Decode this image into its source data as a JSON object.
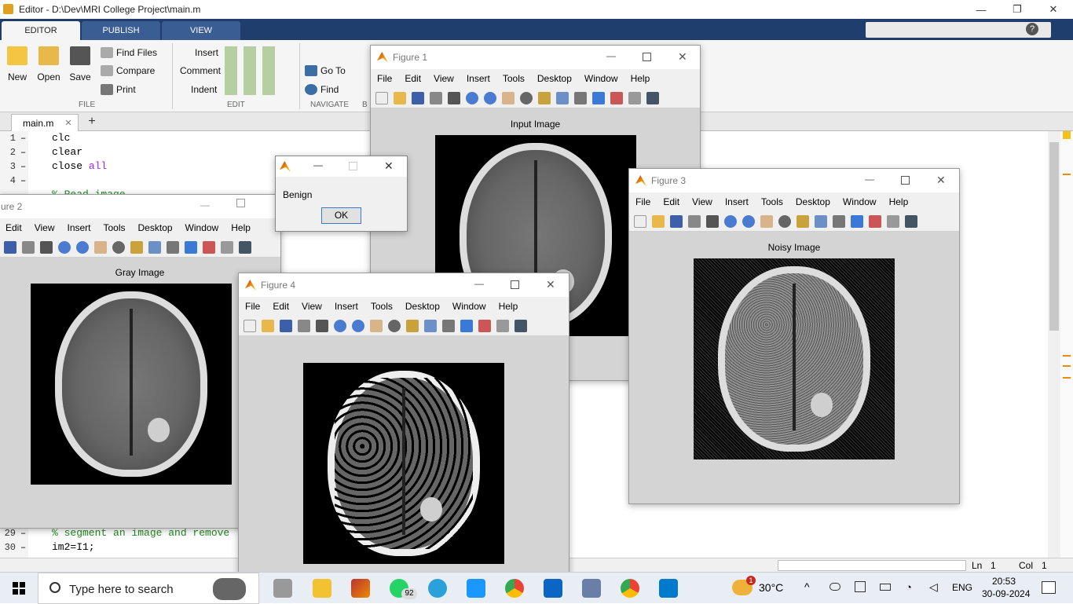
{
  "window": {
    "title": "Editor - D:\\Dev\\MRI College Project\\main.m",
    "minimize": "—",
    "maximize": "❐",
    "close": "✕"
  },
  "ribbon_tabs": [
    "EDITOR",
    "PUBLISH",
    "VIEW"
  ],
  "ribbon": {
    "new": "New",
    "open": "Open",
    "save": "Save",
    "find_files": "Find Files",
    "compare": "Compare",
    "print": "Print",
    "insert": "Insert",
    "comment": "Comment",
    "indent": "Indent",
    "goto": "Go To",
    "find": "Find",
    "groups": {
      "file": "FILE",
      "edit": "EDIT",
      "navigate": "NAVIGATE",
      "b": "B"
    }
  },
  "file_tab": {
    "name": "main.m",
    "close": "✕",
    "add": "+"
  },
  "code": {
    "lines": [
      {
        "num": "1",
        "text": "clc"
      },
      {
        "num": "2",
        "text": "clear"
      },
      {
        "num": "3",
        "text": "close",
        "keyword": "all"
      },
      {
        "num": "4",
        "text": ""
      },
      {
        "num": "29",
        "text": "% segment an image and remove"
      },
      {
        "num": "30",
        "text": "im2=I1;"
      }
    ],
    "partial_comment": "% Read image"
  },
  "figure_menu": [
    "File",
    "Edit",
    "View",
    "Insert",
    "Tools",
    "Desktop",
    "Window",
    "Help"
  ],
  "figures": {
    "fig1": {
      "title": "Figure 1",
      "image_title": "Input Image"
    },
    "fig2": {
      "title": "ure 2",
      "image_title": "Gray Image",
      "menu": [
        "Edit",
        "View",
        "Insert",
        "Tools",
        "Desktop",
        "Window",
        "Help"
      ]
    },
    "fig3": {
      "title": "Figure 3",
      "image_title": "Noisy Image"
    },
    "fig4": {
      "title": "Figure 4"
    }
  },
  "dialog": {
    "message": "Benign",
    "ok": "OK"
  },
  "status": {
    "ln_label": "Ln",
    "ln": "1",
    "col_label": "Col",
    "col": "1"
  },
  "taskbar": {
    "search_placeholder": "Type here to search",
    "temperature": "30°C",
    "language": "ENG",
    "time": "20:53",
    "date": "30-09-2024",
    "whatsapp_badge": "92",
    "weather_badge": "1"
  },
  "colors": {
    "ribbon_tab_bg": "#1f3e6e",
    "taskbar": "#e9eef4",
    "keyword": "#a020f0",
    "comment": "#228b22"
  }
}
